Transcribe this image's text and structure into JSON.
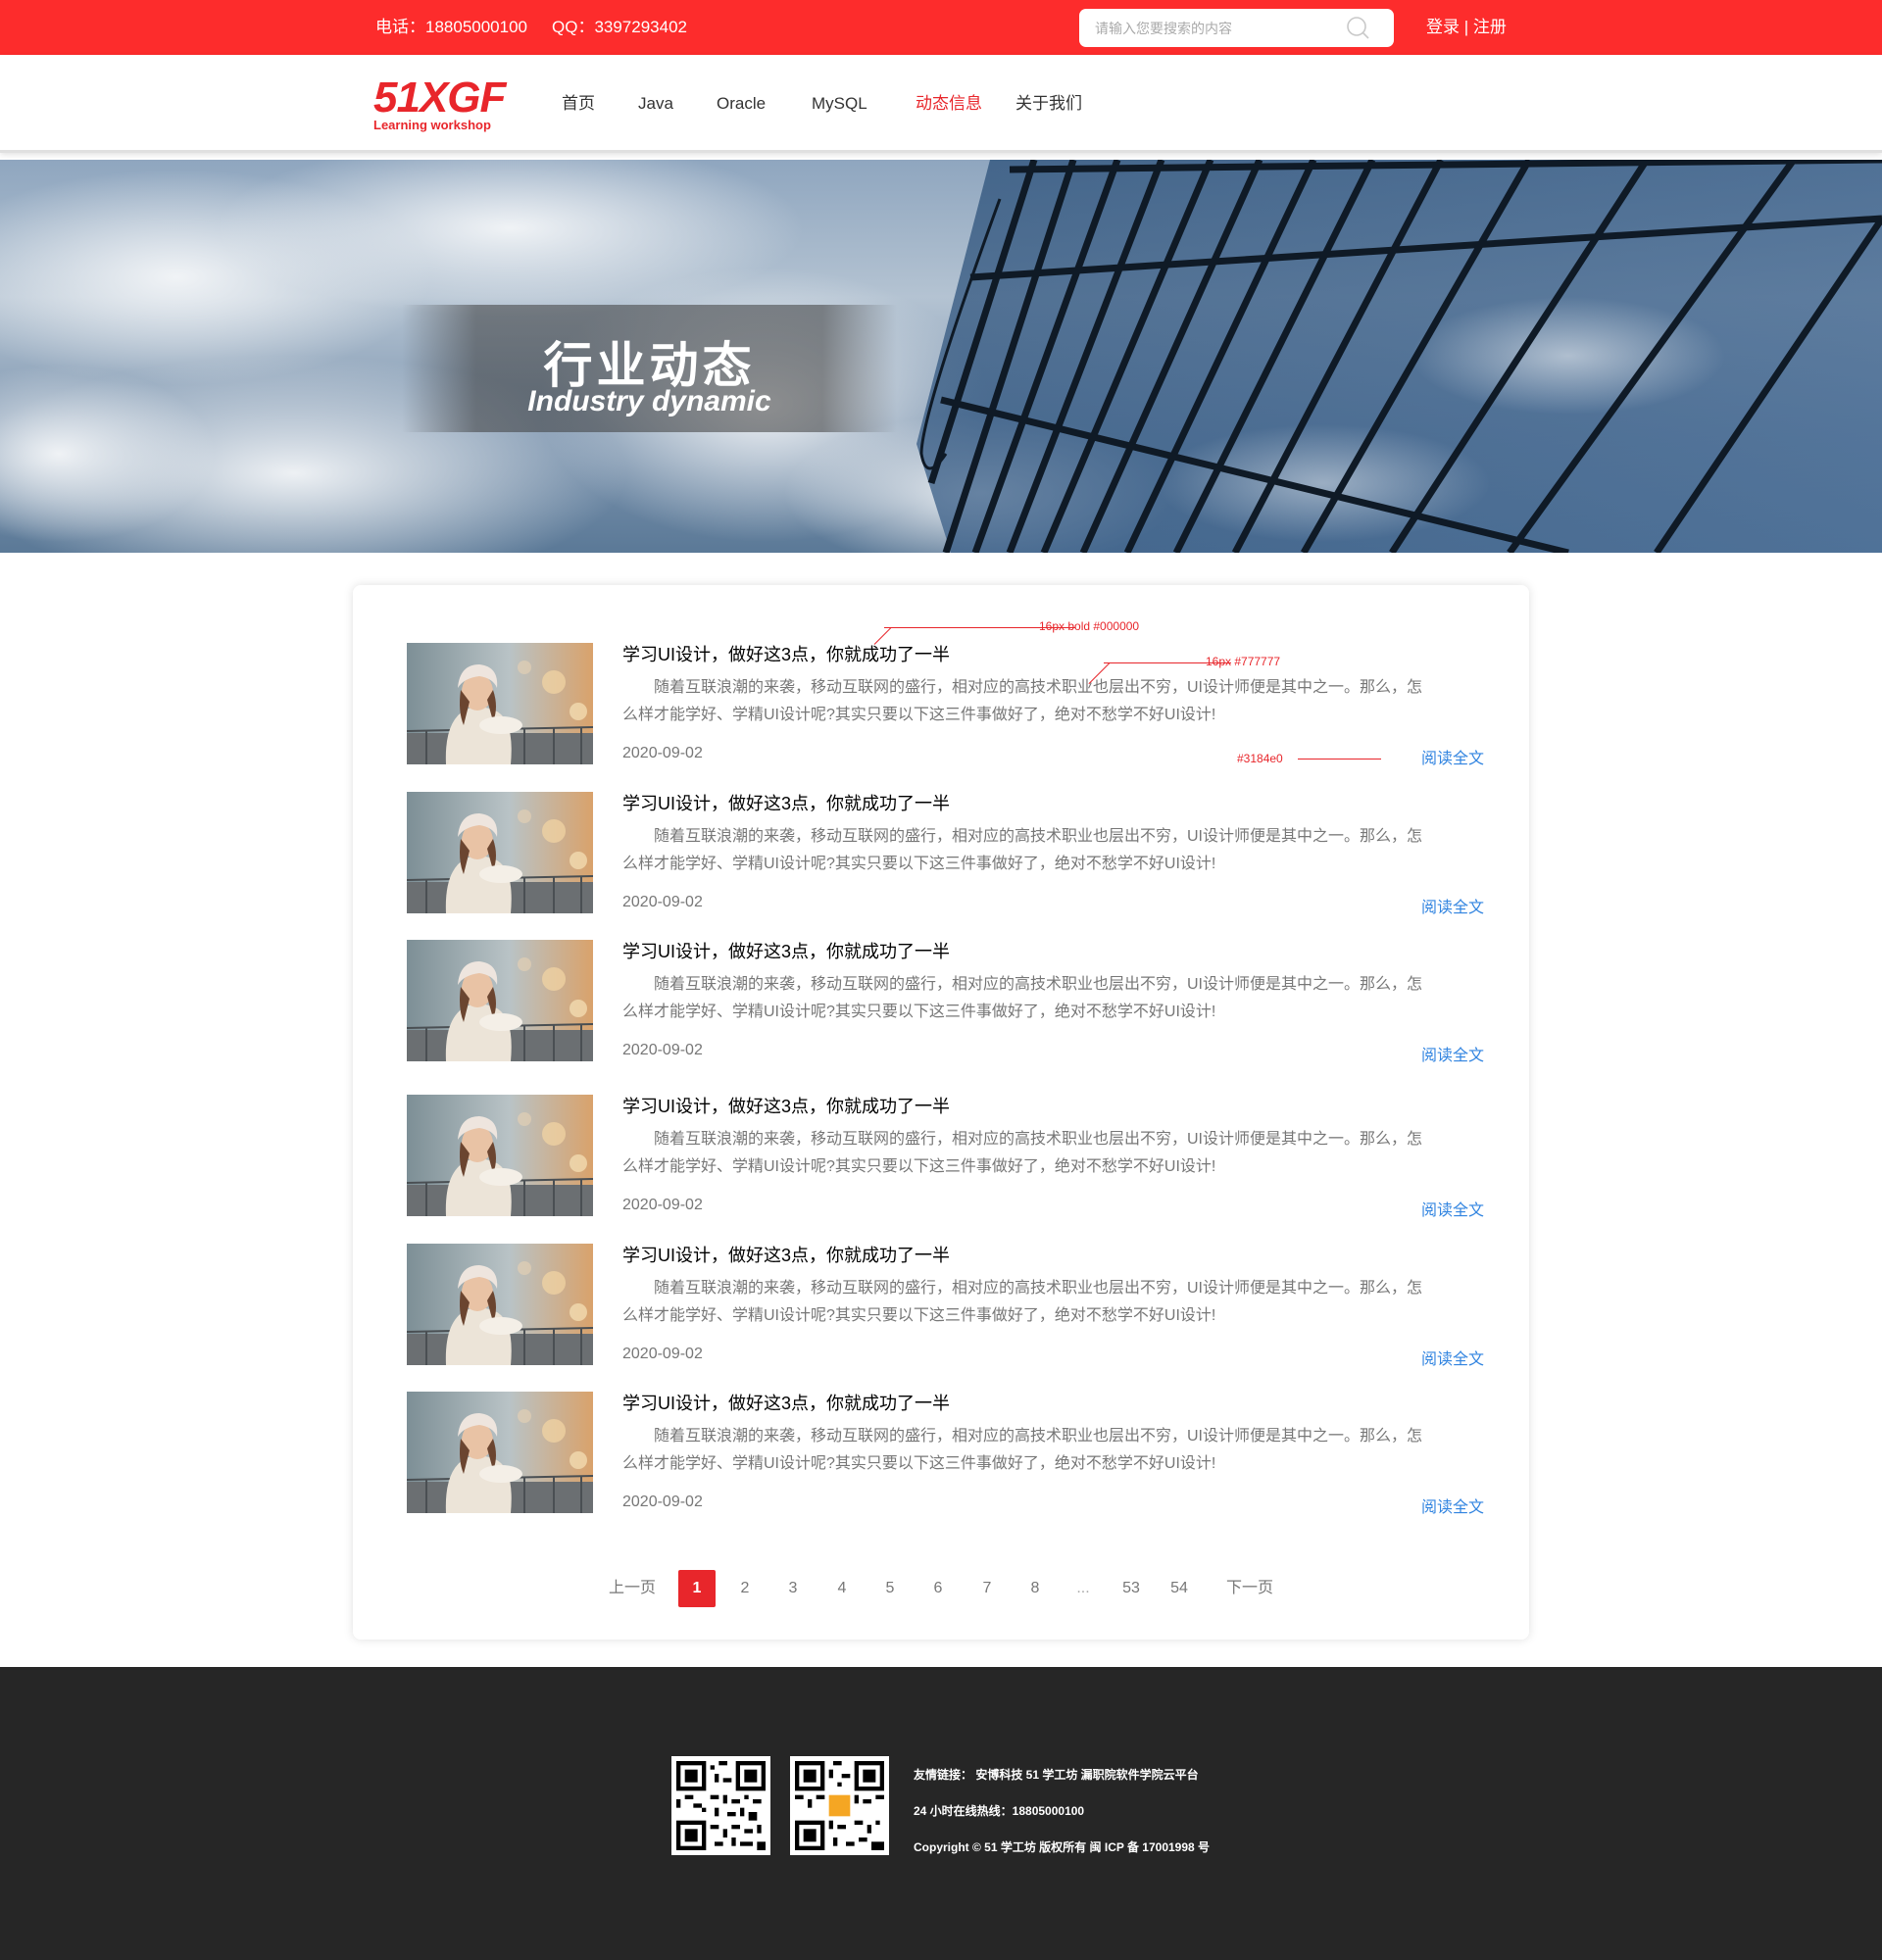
{
  "topbar": {
    "phone_label": "电话：18805000100",
    "qq_label": "QQ：3397293402",
    "search_placeholder": "请输入您要搜索的内容",
    "login": "登录",
    "separator": "|",
    "register": "注册"
  },
  "logo": {
    "text": "51XGF",
    "sub": "Learning workshop"
  },
  "nav": {
    "items": [
      {
        "label": "首页"
      },
      {
        "label": "Java"
      },
      {
        "label": "Oracle"
      },
      {
        "label": "MySQL"
      },
      {
        "label": "动态信息",
        "active": true
      },
      {
        "label": "关于我们"
      }
    ]
  },
  "banner": {
    "title": "行业动态",
    "subtitle": "Industry dynamic"
  },
  "articles": [
    {
      "title": "学习UI设计，做好这3点，你就成功了一半",
      "body": "随着互联浪潮的来袭，移动互联网的盛行，相对应的高技术职业也层出不穷，UI设计师便是其中之一。那么，怎么样才能学好、学精UI设计呢?其实只要以下这三件事做好了，绝对不愁学不好UI设计!",
      "date": "2020-09-02",
      "more": "阅读全文"
    },
    {
      "title": "学习UI设计，做好这3点，你就成功了一半",
      "body": "随着互联浪潮的来袭，移动互联网的盛行，相对应的高技术职业也层出不穷，UI设计师便是其中之一。那么，怎么样才能学好、学精UI设计呢?其实只要以下这三件事做好了，绝对不愁学不好UI设计!",
      "date": "2020-09-02",
      "more": "阅读全文"
    },
    {
      "title": "学习UI设计，做好这3点，你就成功了一半",
      "body": "随着互联浪潮的来袭，移动互联网的盛行，相对应的高技术职业也层出不穷，UI设计师便是其中之一。那么，怎么样才能学好、学精UI设计呢?其实只要以下这三件事做好了，绝对不愁学不好UI设计!",
      "date": "2020-09-02",
      "more": "阅读全文"
    },
    {
      "title": "学习UI设计，做好这3点，你就成功了一半",
      "body": "随着互联浪潮的来袭，移动互联网的盛行，相对应的高技术职业也层出不穷，UI设计师便是其中之一。那么，怎么样才能学好、学精UI设计呢?其实只要以下这三件事做好了，绝对不愁学不好UI设计!",
      "date": "2020-09-02",
      "more": "阅读全文"
    },
    {
      "title": "学习UI设计，做好这3点，你就成功了一半",
      "body": "随着互联浪潮的来袭，移动互联网的盛行，相对应的高技术职业也层出不穷，UI设计师便是其中之一。那么，怎么样才能学好、学精UI设计呢?其实只要以下这三件事做好了，绝对不愁学不好UI设计!",
      "date": "2020-09-02",
      "more": "阅读全文"
    },
    {
      "title": "学习UI设计，做好这3点，你就成功了一半",
      "body": "随着互联浪潮的来袭，移动互联网的盛行，相对应的高技术职业也层出不穷，UI设计师便是其中之一。那么，怎么样才能学好、学精UI设计呢?其实只要以下这三件事做好了，绝对不愁学不好UI设计!",
      "date": "2020-09-02",
      "more": "阅读全文"
    }
  ],
  "annotations": {
    "title_spec": "16px  bold #000000",
    "body_spec": "16px #777777",
    "link_spec": "#3184e0"
  },
  "pagination": {
    "prev": "上一页",
    "pages": [
      "1",
      "2",
      "3",
      "4",
      "5",
      "6",
      "7",
      "8",
      "...",
      "53",
      "54"
    ],
    "current": "1",
    "next": "下一页"
  },
  "footer": {
    "links_line": "友情链接：  安博科技    51 学工坊    漏职院软件学院云平台",
    "hotline": "24 小时在线热线：18805000100",
    "copyright": "Copyright © 51 学工坊 版权所有 闽 ICP 备 17001998 号"
  },
  "colors": {
    "brand_red": "#fd2c2c",
    "accent_red": "#e8262b",
    "link_blue": "#3184e0",
    "body_gray": "#777777",
    "footer_bg": "#262626"
  }
}
